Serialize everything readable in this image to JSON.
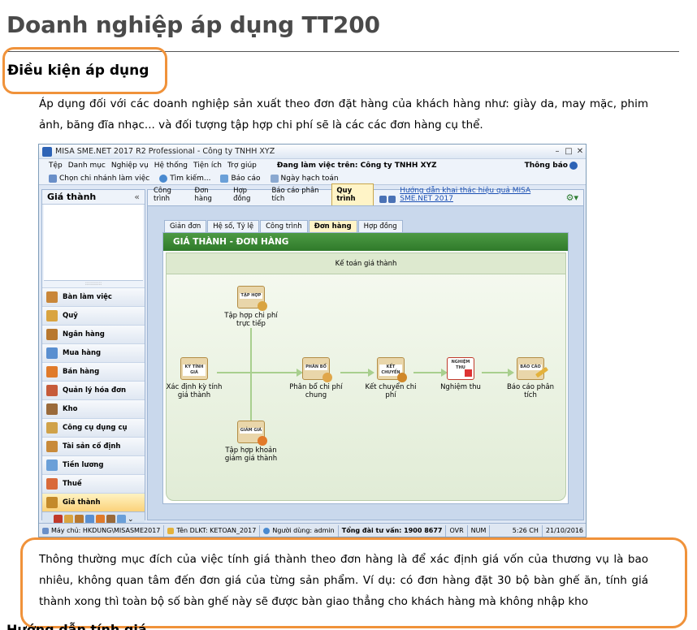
{
  "article": {
    "title": "Doanh nghiệp áp dụng TT200",
    "subheading": "Điều kiện áp dụng",
    "paragraph1": "Áp dụng đối với các doanh nghiệp sản xuất theo đơn đặt hàng của khách hàng như: giày da, may mặc, phim ảnh, băng đĩa nhạc... và đối tượng tập hợp chi phí sẽ là các các đơn hàng cụ thể.",
    "paragraph2": "Thông thường mục đích của việc tính giá thành theo đơn hàng là để xác định giá vốn của thương vụ là bao nhiêu, không quan tâm đến đơn giá của từng sản phẩm. Ví dụ: có đơn hàng đặt 30 bộ bàn ghế ăn, tính giá thành xong thì toàn bộ số bàn ghế này sẽ được bàn giao thẳng cho khách hàng mà không nhập kho",
    "next_heading_cut": "Hướng dẫn tính giá"
  },
  "app": {
    "window_title": "MISA SME.NET 2017 R2 Professional - Công ty TNHH XYZ",
    "menu": [
      "Tệp",
      "Danh mục",
      "Nghiệp vụ",
      "Hệ thống",
      "Tiện ích",
      "Trợ giúp"
    ],
    "session_label": "Đang làm việc trên: Công ty TNHH XYZ",
    "notify_label": "Thông báo",
    "toolbar": [
      "Chọn chi nhánh làm việc",
      "Tìm kiếm...",
      "Báo cáo",
      "Ngày hạch toán"
    ],
    "sidebar": {
      "title": "Giá thành",
      "collapse": "«",
      "grip": "::::::::::",
      "items": [
        {
          "label": "Bàn làm việc",
          "color": "#c9873a"
        },
        {
          "label": "Quỹ",
          "color": "#d9a441"
        },
        {
          "label": "Ngân hàng",
          "color": "#b8782f"
        },
        {
          "label": "Mua hàng",
          "color": "#5a8fd0"
        },
        {
          "label": "Bán hàng",
          "color": "#e07a2a"
        },
        {
          "label": "Quản lý hóa đơn",
          "color": "#c65b3a"
        },
        {
          "label": "Kho",
          "color": "#9a6a3a"
        },
        {
          "label": "Công cụ dụng cụ",
          "color": "#d0a24a"
        },
        {
          "label": "Tài sản cố định",
          "color": "#c88a3a"
        },
        {
          "label": "Tiền lương",
          "color": "#6a9fd8"
        },
        {
          "label": "Thuế",
          "color": "#d96a3a"
        },
        {
          "label": "Giá thành",
          "color": "#c48a2a"
        }
      ]
    },
    "tabs": [
      "Công trình",
      "Đơn hàng",
      "Hợp đồng",
      "Báo cáo phân tích",
      "Quy trình"
    ],
    "help_link": "Hướng dẫn khai thác hiệu quả MISA SME.NET 2017",
    "subtabs": [
      "Giản đơn",
      "Hệ số, Tỷ lệ",
      "Công trình",
      "Đơn hàng",
      "Hợp đồng"
    ],
    "panel_title": "GIÁ THÀNH - ĐƠN HÀNG",
    "panel_band": "Kế toán giá thành",
    "nodes": {
      "direct": {
        "label": "Tập hợp chi phí trực tiếp",
        "badge": "TẬP HỢP"
      },
      "define": {
        "label": "Xác định kỳ tính giá thành",
        "badge": "KỲ TÍNH GIÁ"
      },
      "allocate": {
        "label": "Phân bổ chi phí chung",
        "badge": "PHÂN BỔ"
      },
      "transfer": {
        "label": "Kết chuyển chi phí",
        "badge": "KẾT CHUYỂN"
      },
      "accept": {
        "label": "Nghiệm thu",
        "badge": "NGHIỆM THU"
      },
      "report": {
        "label": "Báo cáo phân tích",
        "badge": "BÁO CÁO"
      },
      "reduce": {
        "label": "Tập hợp khoản giảm giá thành",
        "badge": "GIẢM GIÁ"
      }
    },
    "status": {
      "server": "Máy chủ: HKDUNG\\MISASME2017",
      "db": "Tên DLKT: KETOAN_2017",
      "user": "Người dùng: admin",
      "hotline": "Tổng đài tư vấn: 1900 8677",
      "ovr": "OVR",
      "num": "NUM",
      "time": "5:26 CH",
      "date": "21/10/2016"
    }
  }
}
